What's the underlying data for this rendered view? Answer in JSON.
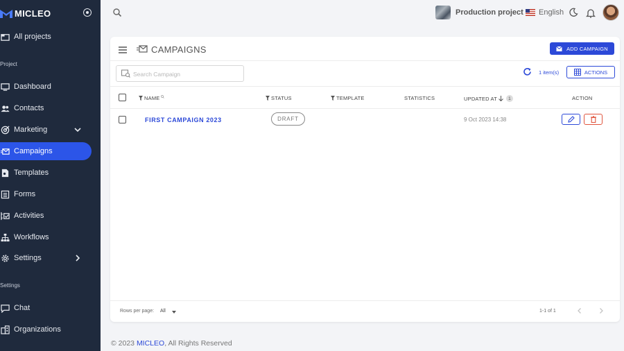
{
  "brand": {
    "name": "MICLEO"
  },
  "sidebar": {
    "all_projects": "All projects",
    "section_project": "Project",
    "section_settings": "Settings",
    "items": [
      {
        "label": "Dashboard",
        "icon": "dashboard-icon"
      },
      {
        "label": "Contacts",
        "icon": "contacts-icon"
      },
      {
        "label": "Marketing",
        "icon": "marketing-icon"
      },
      {
        "label": "Campaigns",
        "icon": "campaigns-icon",
        "active": true
      },
      {
        "label": "Templates",
        "icon": "templates-icon"
      },
      {
        "label": "Forms",
        "icon": "forms-icon"
      },
      {
        "label": "Activities",
        "icon": "activities-icon"
      },
      {
        "label": "Workflows",
        "icon": "workflows-icon"
      },
      {
        "label": "Settings",
        "icon": "settings-icon"
      }
    ],
    "settings_items": [
      {
        "label": "Chat",
        "icon": "chat-icon"
      },
      {
        "label": "Organizations",
        "icon": "organizations-icon"
      }
    ]
  },
  "topbar": {
    "project_name": "Production project",
    "language": "English"
  },
  "page": {
    "title": "CAMPAIGNS",
    "add_button": "ADD CAMPAIGN",
    "search_placeholder": "Search Campaign",
    "item_count": "1 item(s)",
    "actions_button": "ACTIONS"
  },
  "table": {
    "headers": {
      "name": "NAME",
      "status": "STATUS",
      "template": "TEMPLATE",
      "statistics": "STATISTICS",
      "updated_at": "UPDATED AT",
      "updated_sort_index": "1",
      "action": "ACTION"
    },
    "rows": [
      {
        "name": "FIRST CAMPAIGN 2023",
        "status": "DRAFT",
        "template": "",
        "statistics": "",
        "updated_at": "9 Oct 2023 14:38"
      }
    ]
  },
  "pagination": {
    "rows_per_page_label": "Rows per page:",
    "rows_per_page_value": "All",
    "range": "1-1 of 1"
  },
  "footer": {
    "prefix": "© 2023 ",
    "brand": "MICLEO",
    "suffix": ", All Rights Reserved"
  },
  "colors": {
    "sidebar_bg": "#1f2a3d",
    "accent": "#2c49d8",
    "active_nav": "#2c55e8",
    "danger": "#e0543d"
  }
}
